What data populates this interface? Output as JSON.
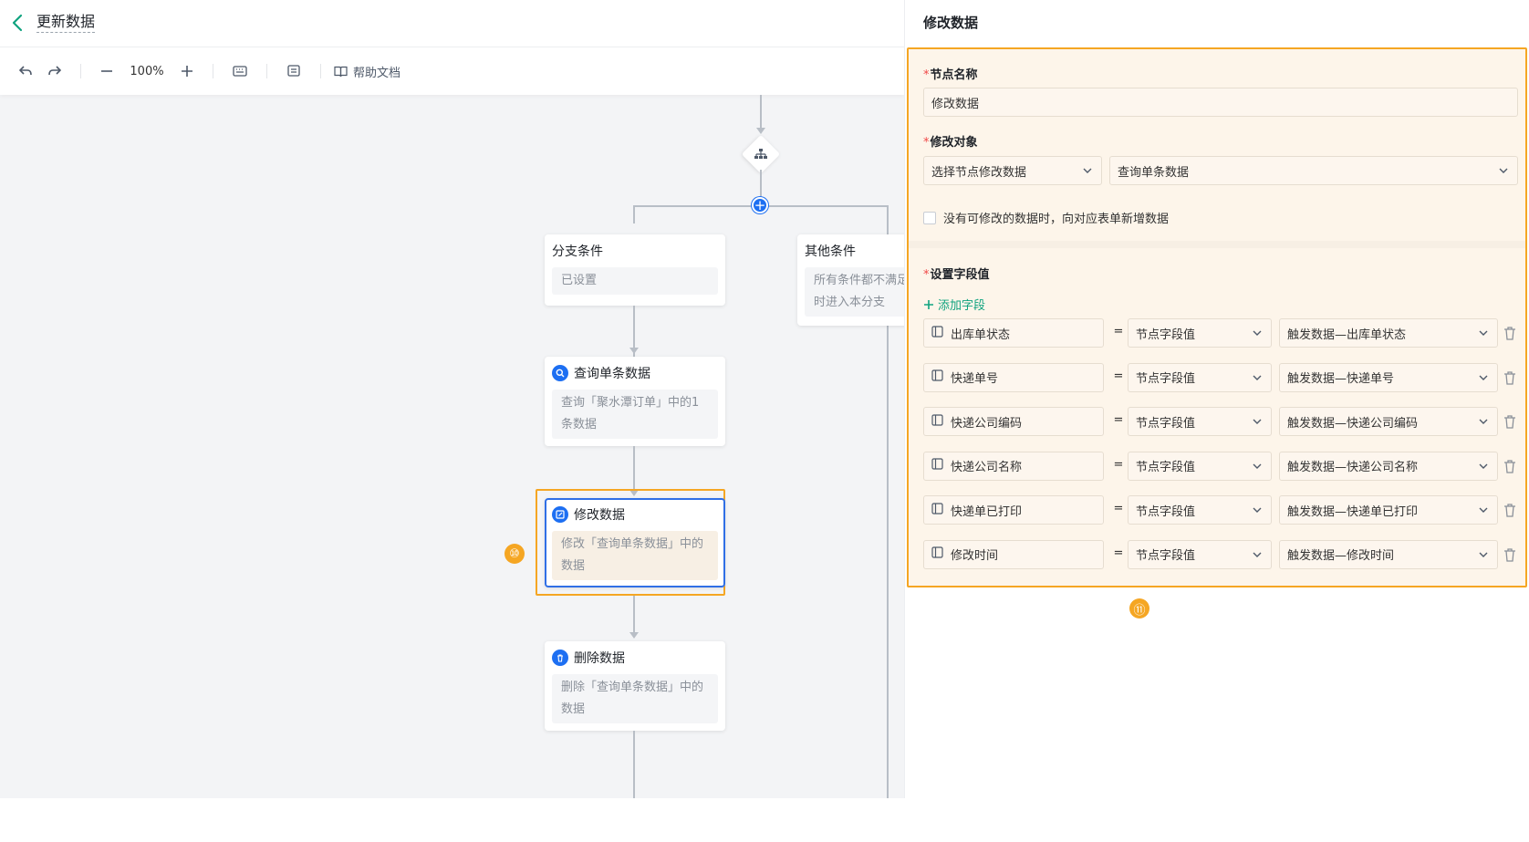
{
  "header": {
    "title": "更新数据"
  },
  "toolbar": {
    "zoom": "100%",
    "help_label": "帮助文档"
  },
  "flow": {
    "branch_node": {
      "title": "分支条件",
      "desc": "已设置"
    },
    "other_node": {
      "title": "其他条件",
      "desc": "所有条件都不满足时进入本分支"
    },
    "query_node": {
      "title": "查询单条数据",
      "desc": "查询「聚水潭订单」中的1条数据"
    },
    "update_node": {
      "title": "修改数据",
      "desc": "修改「查询单条数据」中的数据"
    },
    "delete_node": {
      "title": "删除数据",
      "desc": "删除「查询单条数据」中的数据"
    },
    "badge_left": "⑩",
    "badge_right": "⑪"
  },
  "panel": {
    "title": "修改数据",
    "node_name_label": "节点名称",
    "node_name_value": "修改数据",
    "target_label": "修改对象",
    "target_mode": "选择节点修改数据",
    "target_node": "查询单条数据",
    "checkbox_label": "没有可修改的数据时，向对应表单新增数据",
    "fields_label": "设置字段值",
    "add_field_label": "添加字段",
    "equals": "=",
    "fields": [
      {
        "name": "出库单状态",
        "type": "节点字段值",
        "value": "触发数据—出库单状态"
      },
      {
        "name": "快递单号",
        "type": "节点字段值",
        "value": "触发数据—快递单号"
      },
      {
        "name": "快递公司编码",
        "type": "节点字段值",
        "value": "触发数据—快递公司编码"
      },
      {
        "name": "快递公司名称",
        "type": "节点字段值",
        "value": "触发数据—快递公司名称"
      },
      {
        "name": "快递单已打印",
        "type": "节点字段值",
        "value": "触发数据—快递单已打印"
      },
      {
        "name": "修改时间",
        "type": "节点字段值",
        "value": "触发数据—修改时间"
      }
    ]
  },
  "colors": {
    "accent": "#1d6ff2",
    "highlight": "#f5a623",
    "add": "#10a37f"
  }
}
